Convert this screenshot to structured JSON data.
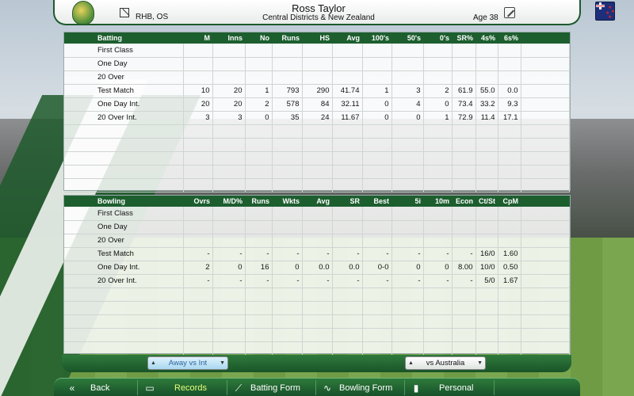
{
  "header": {
    "player_name": "Ross Taylor",
    "team": "Central Districts & New Zealand",
    "hand_style": "RHB, OS",
    "age": "Age 38"
  },
  "batting": {
    "columns": [
      "Batting",
      "M",
      "Inns",
      "No",
      "Runs",
      "HS",
      "Avg",
      "100's",
      "50's",
      "0's",
      "SR%",
      "4s%",
      "6s%"
    ],
    "rows": [
      [
        "First Class",
        "",
        "",
        "",
        "",
        "",
        "",
        "",
        "",
        "",
        "",
        "",
        ""
      ],
      [
        "One Day",
        "",
        "",
        "",
        "",
        "",
        "",
        "",
        "",
        "",
        "",
        "",
        ""
      ],
      [
        "20 Over",
        "",
        "",
        "",
        "",
        "",
        "",
        "",
        "",
        "",
        "",
        "",
        ""
      ],
      [
        "Test Match",
        "10",
        "20",
        "1",
        "793",
        "290",
        "41.74",
        "1",
        "3",
        "2",
        "61.9",
        "55.0",
        "0.0"
      ],
      [
        "One Day Int.",
        "20",
        "20",
        "2",
        "578",
        "84",
        "32.11",
        "0",
        "4",
        "0",
        "73.4",
        "33.2",
        "9.3"
      ],
      [
        "20 Over Int.",
        "3",
        "3",
        "0",
        "35",
        "24",
        "11.67",
        "0",
        "0",
        "1",
        "72.9",
        "11.4",
        "17.1"
      ]
    ]
  },
  "bowling": {
    "columns": [
      "Bowling",
      "Ovrs",
      "M/D%",
      "Runs",
      "Wkts",
      "Avg",
      "SR",
      "Best",
      "5i",
      "10m",
      "Econ",
      "Ct/St",
      "CpM"
    ],
    "rows": [
      [
        "First Class",
        "",
        "",
        "",
        "",
        "",
        "",
        "",
        "",
        "",
        "",
        "",
        ""
      ],
      [
        "One Day",
        "",
        "",
        "",
        "",
        "",
        "",
        "",
        "",
        "",
        "",
        "",
        ""
      ],
      [
        "20 Over",
        "",
        "",
        "",
        "",
        "",
        "",
        "",
        "",
        "",
        "",
        "",
        ""
      ],
      [
        "Test Match",
        "-",
        "-",
        "-",
        "-",
        "-",
        "-",
        "-",
        "-",
        "-",
        "-",
        "16/0",
        "1.60"
      ],
      [
        "One Day Int.",
        "2",
        "0",
        "16",
        "0",
        "0.0",
        "0.0",
        "0-0",
        "0",
        "0",
        "8.00",
        "10/0",
        "0.50"
      ],
      [
        "20 Over Int.",
        "-",
        "-",
        "-",
        "-",
        "-",
        "-",
        "-",
        "-",
        "-",
        "-",
        "5/0",
        "1.67"
      ]
    ]
  },
  "filters": {
    "left_value": "Away vs Int",
    "right_value": "vs Australia"
  },
  "nav": {
    "back": "Back",
    "records": "Records",
    "batting_form": "Batting Form",
    "bowling_form": "Bowling Form",
    "personal": "Personal"
  },
  "colors": {
    "accent_green": "#1d5e2f",
    "active_nav": "#e6ff7a",
    "selected_filter": "#2a64a0"
  }
}
